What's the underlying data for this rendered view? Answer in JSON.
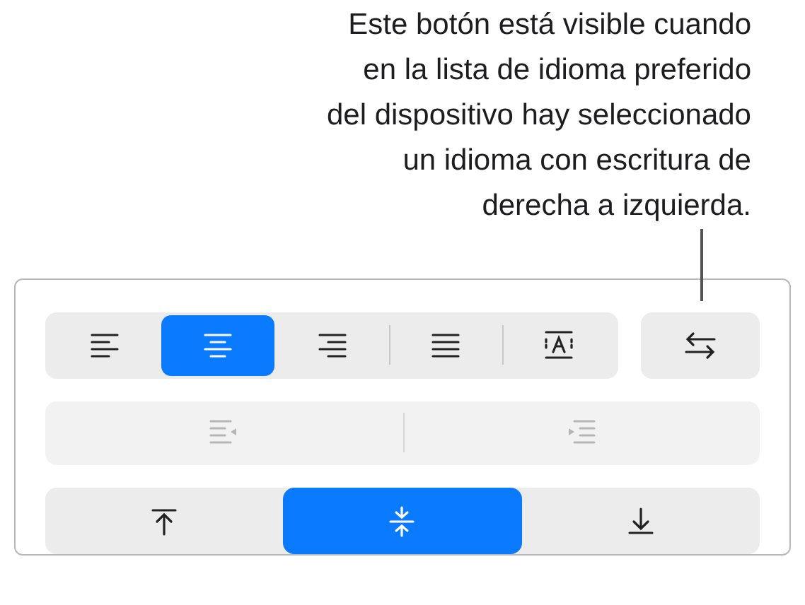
{
  "callout": {
    "text": "Este botón está visible cuando\nen la lista de idioma preferido\ndel dispositivo hay seleccionado\nun idioma con escritura de\nderecha a izquierda."
  },
  "alignment": [
    {
      "kind": "left",
      "selected": false
    },
    {
      "kind": "center",
      "selected": true
    },
    {
      "kind": "right",
      "selected": false
    },
    {
      "kind": "justify",
      "selected": false
    },
    {
      "kind": "fit",
      "selected": false
    }
  ],
  "direction_button": {
    "kind": "rtl"
  },
  "indent": [
    {
      "kind": "decrease",
      "disabled": true
    },
    {
      "kind": "increase",
      "disabled": true
    }
  ],
  "vertical": [
    {
      "kind": "top",
      "selected": false
    },
    {
      "kind": "middle",
      "selected": true
    },
    {
      "kind": "bottom",
      "selected": false
    }
  ]
}
